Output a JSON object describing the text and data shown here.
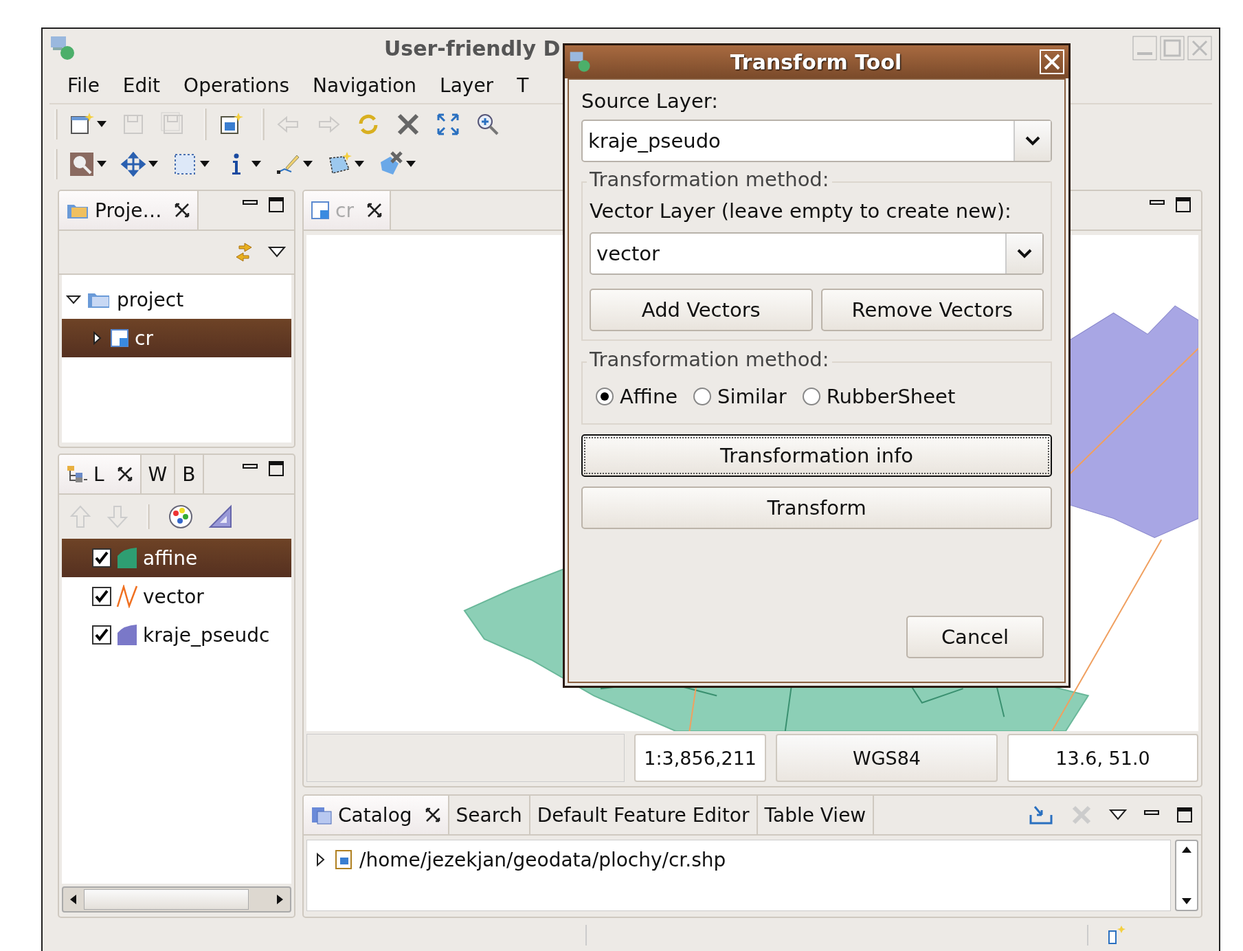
{
  "window": {
    "title": "User-friendly D"
  },
  "menu": [
    "File",
    "Edit",
    "Operations",
    "Navigation",
    "Layer",
    "T"
  ],
  "toolbars": [
    [
      [
        {
          "kind": "new",
          "dropdown": true,
          "disabled": false
        },
        {
          "kind": "save",
          "dropdown": false,
          "disabled": true
        },
        {
          "kind": "save-all",
          "dropdown": false,
          "disabled": true
        }
      ],
      [
        {
          "kind": "new-page",
          "dropdown": false,
          "disabled": false
        }
      ],
      [
        {
          "kind": "back",
          "dropdown": false,
          "disabled": true
        },
        {
          "kind": "forward",
          "dropdown": false,
          "disabled": true
        },
        {
          "kind": "refresh",
          "dropdown": false,
          "disabled": false
        },
        {
          "kind": "cross",
          "dropdown": false,
          "disabled": false
        },
        {
          "kind": "fit",
          "dropdown": false,
          "disabled": false
        },
        {
          "kind": "zoom-in",
          "dropdown": false,
          "disabled": false
        }
      ]
    ],
    [
      [
        {
          "kind": "zoom-tool",
          "dropdown": true,
          "disabled": false
        },
        {
          "kind": "pan",
          "dropdown": true,
          "disabled": false
        },
        {
          "kind": "select",
          "dropdown": true,
          "disabled": false
        },
        {
          "kind": "info",
          "dropdown": true,
          "disabled": false
        },
        {
          "kind": "edit",
          "dropdown": true,
          "disabled": false
        },
        {
          "kind": "add-shape",
          "dropdown": true,
          "disabled": false
        },
        {
          "kind": "delete-shape",
          "dropdown": true,
          "disabled": false
        }
      ]
    ]
  ],
  "project_panel": {
    "tab": "Proje…",
    "tree": [
      {
        "label": "project",
        "expanded": true,
        "children": [
          {
            "label": "cr",
            "expanded": false,
            "selected": true
          }
        ]
      }
    ]
  },
  "layers_panel": {
    "tabs": [
      {
        "label": "L",
        "selected": true
      },
      {
        "label": "W",
        "selected": false
      },
      {
        "label": "B",
        "selected": false
      }
    ],
    "layers": [
      {
        "name": "affine",
        "checked": true,
        "selected": true,
        "kind": "polygon",
        "color": "#2e9e72"
      },
      {
        "name": "vector",
        "checked": true,
        "selected": false,
        "kind": "line",
        "color": "#f07020"
      },
      {
        "name": "kraje_pseudc",
        "checked": true,
        "selected": false,
        "kind": "polygon",
        "color": "#7a78c8"
      }
    ]
  },
  "map_panel": {
    "tab": "cr",
    "status": {
      "scale": "1:3,856,211",
      "crs": "WGS84",
      "coordinates": "13.6, 51.0"
    }
  },
  "bottom_panel": {
    "tabs": [
      {
        "label": "Catalog",
        "selected": true
      },
      {
        "label": "Search",
        "selected": false
      },
      {
        "label": "Default Feature Editor",
        "selected": false
      },
      {
        "label": "Table View",
        "selected": false
      }
    ],
    "catalog": [
      {
        "path": "/home/jezekjan/geodata/plochy/cr.shp",
        "expanded": false
      }
    ]
  },
  "dialog": {
    "title": "Transform Tool",
    "source_label": "Source Layer:",
    "source_value": "kraje_pseudo",
    "vector_group": {
      "legend": "Transformation method:",
      "label": "Vector Layer (leave empty to create new):",
      "value": "vector",
      "buttons": [
        "Add Vectors",
        "Remove Vectors"
      ]
    },
    "method_group": {
      "legend": "Transformation method:",
      "options": [
        {
          "label": "Affine",
          "selected": true
        },
        {
          "label": "Similar",
          "selected": false
        },
        {
          "label": "RubberSheet",
          "selected": false
        }
      ]
    },
    "buttons": [
      {
        "label": "Transformation info",
        "focused": true
      },
      {
        "label": "Transform",
        "focused": false
      }
    ],
    "cancel": "Cancel"
  }
}
